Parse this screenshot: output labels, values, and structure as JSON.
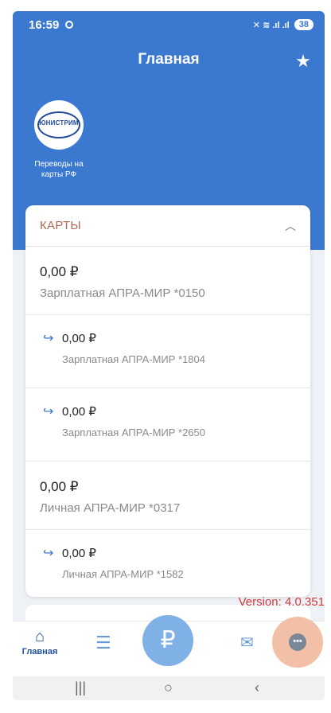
{
  "status_bar": {
    "time": "16:59",
    "signal_text": "✕ ≋ .ıl .ıl",
    "battery": "38"
  },
  "header": {
    "title": "Главная"
  },
  "quick_actions": [
    {
      "logo_text": "ЮНИСТРИМ",
      "label_line1": "Переводы на",
      "label_line2": "карты РФ"
    }
  ],
  "cards_section": {
    "title": "КАРТЫ",
    "items": [
      {
        "amount": "0,00 ₽",
        "name": "Зарплатная АПРА-МИР *0150",
        "child": false
      },
      {
        "amount": "0,00 ₽",
        "name": "Зарплатная АПРА-МИР *1804",
        "child": true
      },
      {
        "amount": "0,00 ₽",
        "name": "Зарплатная АПРА-МИР *2650",
        "child": true
      },
      {
        "amount": "0,00 ₽",
        "name": "Личная АПРА-МИР *0317",
        "child": false
      },
      {
        "amount": "0,00 ₽",
        "name": "Личная АПРА-МИР *1582",
        "child": true
      }
    ]
  },
  "version_text": "Version: 4.0.351",
  "bottom_nav": {
    "home_label": "Главная",
    "ruble_symbol": "₽",
    "more_symbol": "•••"
  },
  "icons": {
    "star": "star-icon",
    "chevron": "chevron-up-icon",
    "sub_card_arrow": "arrow-return-icon",
    "home": "home-icon",
    "list": "list-icon",
    "mail": "mail-icon",
    "more": "more-icon"
  },
  "colors": {
    "brand_blue": "#3b78d0",
    "version_red": "#d23b3b",
    "cards_title": "#b06a56"
  }
}
